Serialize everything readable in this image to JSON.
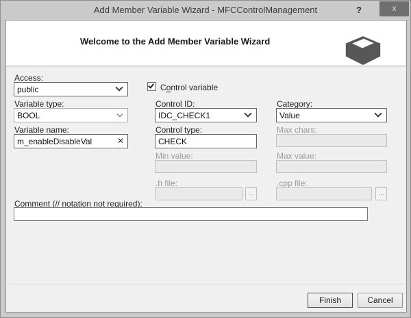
{
  "window": {
    "title": "Add Member Variable Wizard - MFCControlManagement",
    "help_label": "?",
    "close_label": "x"
  },
  "header": {
    "welcome": "Welcome to the Add Member Variable Wizard",
    "icon": "wizard-box-3d-icon",
    "icon_color": "#575757"
  },
  "form": {
    "access": {
      "label": {
        "pre": "",
        "u": "A",
        "post": "ccess:"
      },
      "value": "public",
      "disabled": false
    },
    "variable_type": {
      "label": {
        "pre": "",
        "u": "V",
        "post": "ariable type:"
      },
      "value": "BOOL",
      "disabled": false
    },
    "variable_name": {
      "label": {
        "pre": "Variable ",
        "u": "n",
        "post": "ame:"
      },
      "value": "m_enableDisableVal",
      "clear_icon": "✕",
      "disabled": false
    },
    "control_variable": {
      "label": {
        "pre": "C",
        "u": "o",
        "post": "ntrol variable"
      },
      "checked": true
    },
    "control_id": {
      "label": {
        "pre": "Control ",
        "u": "ID",
        "post": ":"
      },
      "value": "IDC_CHECK1",
      "disabled": false
    },
    "control_type": {
      "label": {
        "pre": "Control t",
        "u": "yp",
        "post": "e:"
      },
      "value": "CHECK",
      "disabled": false
    },
    "category": {
      "label": {
        "pre": "Ca",
        "u": "te",
        "post": "gory:"
      },
      "value": "Value",
      "disabled": false
    },
    "max_chars": {
      "label": {
        "pre": "Ma",
        "u": "x",
        "post": " chars:"
      },
      "value": "",
      "disabled": true
    },
    "min_value": {
      "label": {
        "pre": "Min val",
        "u": "u",
        "post": "e:"
      },
      "value": "",
      "disabled": true
    },
    "max_value": {
      "label": {
        "pre": "Max valu",
        "u": "e",
        "post": ":"
      },
      "value": "",
      "disabled": true
    },
    "h_file": {
      "label": {
        "pre": ".h ",
        "u": "fi",
        "post": "le:"
      },
      "value": "",
      "browse_label": "...",
      "disabled": true
    },
    "cpp_file": {
      "label": {
        "pre": ".c",
        "u": "pp",
        "post": " file:"
      },
      "value": "",
      "browse_label": "...",
      "disabled": true
    },
    "comment": {
      "label": {
        "pre": "Co",
        "u": "mm",
        "post": "ent (// notation not required):"
      },
      "value": "",
      "disabled": false
    }
  },
  "footer": {
    "finish_label": "Finish",
    "cancel_label": "Cancel"
  }
}
